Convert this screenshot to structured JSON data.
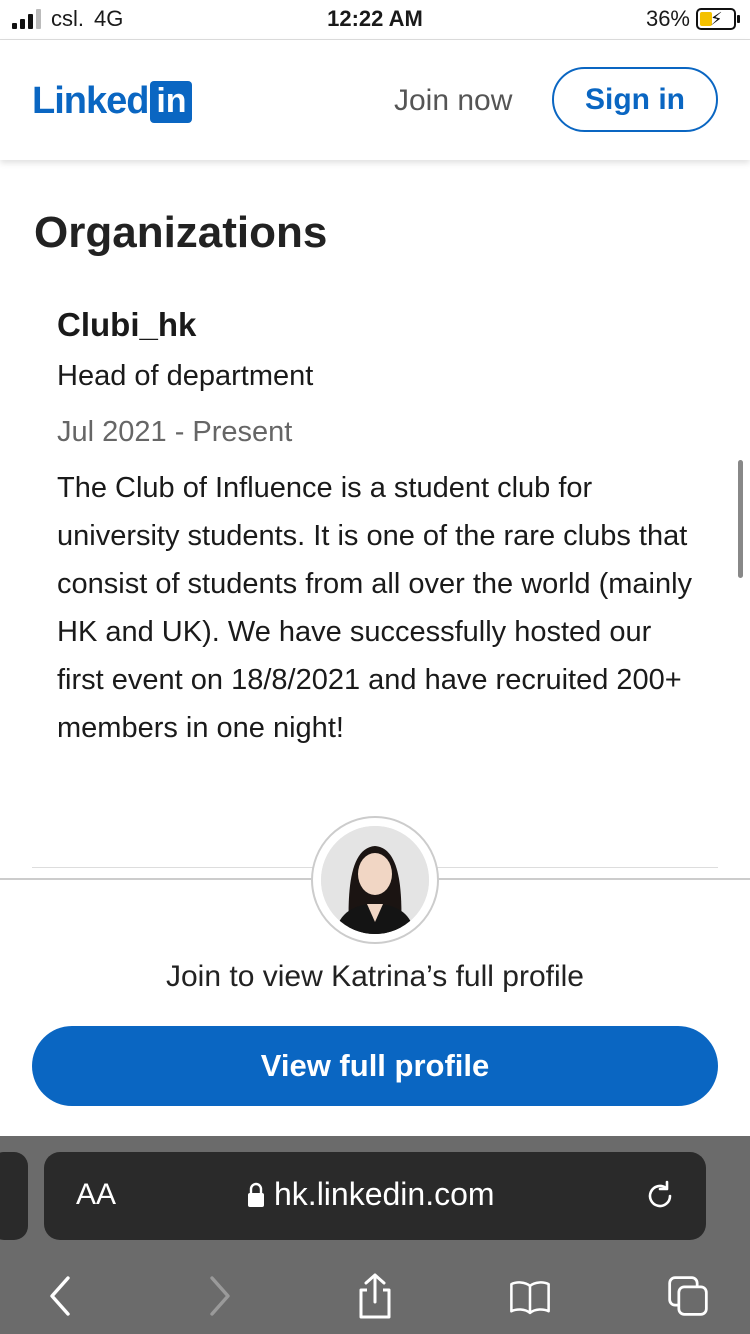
{
  "status_bar": {
    "carrier": "csl.",
    "network": "4G",
    "time": "12:22 AM",
    "battery": "36%",
    "battery_level": 0.36,
    "battery_color": "#f4c100"
  },
  "header": {
    "logo_text": "Linked",
    "logo_badge": "in",
    "join_now_label": "Join now",
    "sign_in_label": "Sign in",
    "brand_color": "#0a66c2"
  },
  "organizations": {
    "section_title": "Organizations",
    "items": [
      {
        "name": "Clubi_hk",
        "role": "Head of department",
        "dates": "Jul 2021 - Present",
        "description": "The Club of Influence is a student club for university students. It is one of the rare clubs that consist of students from all over the world (mainly HK and UK). We have successfully hosted our first event on 18/8/2021 and have recruited 200+ members in one night!"
      }
    ]
  },
  "join_card": {
    "message": "Join to view Katrina’s full profile",
    "button_label": "View full profile"
  },
  "browser": {
    "text_size_label": "AA",
    "url": "hk.linkedin.com",
    "toolbar_icons": [
      "back-icon",
      "forward-icon",
      "share-icon",
      "bookmarks-icon",
      "tabs-icon"
    ]
  }
}
